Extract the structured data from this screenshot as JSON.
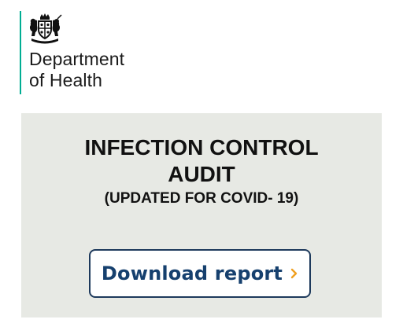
{
  "organisation": {
    "name_line1": "Department",
    "name_line2": "of Health",
    "crest_icon": "royal-coat-of-arms-icon",
    "accent_color": "#00ad93"
  },
  "panel": {
    "title_line1": "INFECTION CONTROL",
    "title_line2": "AUDIT",
    "subtitle": "(UPDATED FOR COVID- 19)",
    "background_color": "#e7e9e4"
  },
  "download_button": {
    "label": "Download report",
    "icon": "chevron-right-icon",
    "text_color": "#16406e",
    "icon_color": "#f0a020"
  }
}
